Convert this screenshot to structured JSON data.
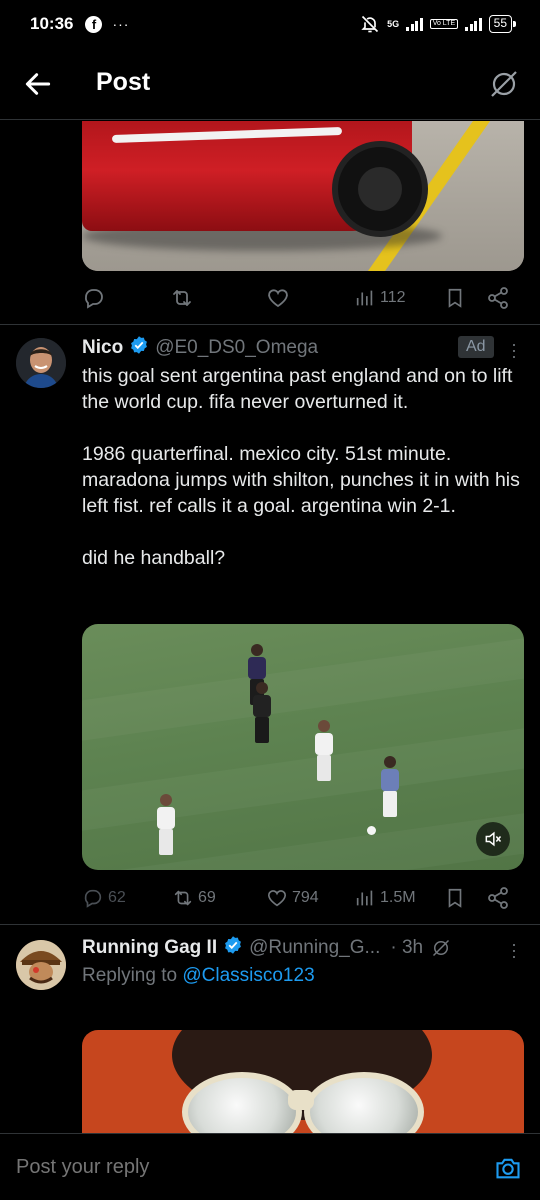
{
  "status_bar": {
    "time": "10:36",
    "facebook_glyph": "f",
    "more_dots": "···",
    "network": "5G",
    "volte": "Vo LTE",
    "battery": "55",
    "icons": [
      "facebook-icon",
      "bell-off-icon",
      "signal-icon",
      "battery-icon"
    ]
  },
  "header": {
    "title": "Post",
    "icons": [
      "back-arrow-icon",
      "grok-icon"
    ]
  },
  "colors": {
    "background": "#000000",
    "text": "#e7e9ea",
    "muted": "#71767b",
    "accent": "#1d9bf0",
    "divider": "#2f3336"
  },
  "top_actions": {
    "views": "112"
  },
  "ad_tweet": {
    "name": "Nico",
    "handle": "@E0_DS0_Omega",
    "ad_label": "Ad",
    "paragraphs": [
      "this goal sent argentina past england and on to lift the world cup. fifa never overturned it.",
      "1986 quarterfinal. mexico city. 51st minute. maradona jumps with shilton, punches it in with his left fist. ref calls it a goal. argentina win 2-1.",
      "did he handball?"
    ],
    "stats": {
      "replies": "62",
      "reposts": "69",
      "likes": "794",
      "views": "1.5M"
    }
  },
  "reply_tweet": {
    "name": "Running Gag II",
    "handle": "@Running_G...",
    "time": "· 3h",
    "replying_prefix": "Replying to",
    "replying_to": "@Classisco123"
  },
  "reply_bar": {
    "placeholder": "Post your reply"
  }
}
